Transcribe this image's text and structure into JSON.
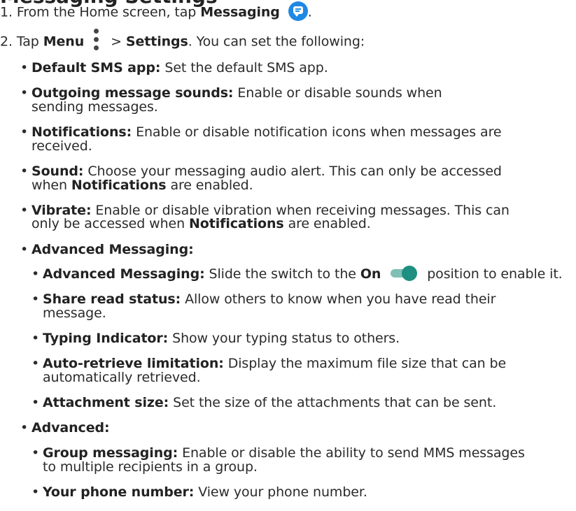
{
  "heading": "Messaging Settings",
  "step1": {
    "num": "1.",
    "pre": "From the Home screen, tap",
    "bold": "Messaging",
    "post": "."
  },
  "step2": {
    "num": "2.",
    "pre": "Tap",
    "menu": "Menu",
    "gt": ">",
    "settings": "Settings",
    "post": ". You can set the following:"
  },
  "items": [
    {
      "term": "Default SMS app:",
      "desc": "Set the default SMS app."
    },
    {
      "term": "Outgoing message sounds:",
      "desc": "Enable or disable sounds when",
      "desc2": "sending messages."
    },
    {
      "term": "Notifications:",
      "desc": "Enable or disable notification icons when messages are",
      "desc2": "received."
    },
    {
      "term": "Sound:",
      "desc": "Choose your messaging audio alert. This can only be accessed",
      "desc2a": "when",
      "desc2b": "Notifications",
      "desc2c": "are enabled."
    },
    {
      "term": "Vibrate:",
      "desc": "Enable or disable vibration when receiving messages. This can",
      "desc2a": "only be accessed when",
      "desc2b": "Notifications",
      "desc2c": "are enabled."
    },
    {
      "term": "Advanced Messaging:"
    }
  ],
  "advanced_messaging": [
    {
      "term": "Advanced Messaging:",
      "desc_a": "Slide the switch to the",
      "on": "On",
      "desc_b": "position to enable it."
    },
    {
      "term": "Share read status:",
      "desc": "Allow others to know when you have read their",
      "desc2": "message."
    },
    {
      "term": "Typing Indicator:",
      "desc": "Show your typing status to others."
    },
    {
      "term": "Auto-retrieve limitation:",
      "desc": "Display the maximum file size that can be",
      "desc2": "automatically retrieved."
    },
    {
      "term": "Attachment size:",
      "desc": "Set the size of the attachments that can be sent."
    }
  ],
  "advanced_label": "Advanced:",
  "advanced": [
    {
      "term": "Group messaging:",
      "desc": "Enable or disable the ability to send MMS messages",
      "desc2": "to multiple recipients in a group."
    },
    {
      "term": "Your phone number:",
      "desc": "View your phone number."
    }
  ],
  "bullet": "•",
  "icons": {
    "messaging": "messaging-app-icon",
    "menu": "vertical-dots-menu-icon",
    "toggle": "toggle-switch-on-icon"
  },
  "colors": {
    "messaging_icon": "#1e88e5",
    "toggle_knob": "#1e8f80",
    "toggle_track": "#7fbfb6"
  }
}
